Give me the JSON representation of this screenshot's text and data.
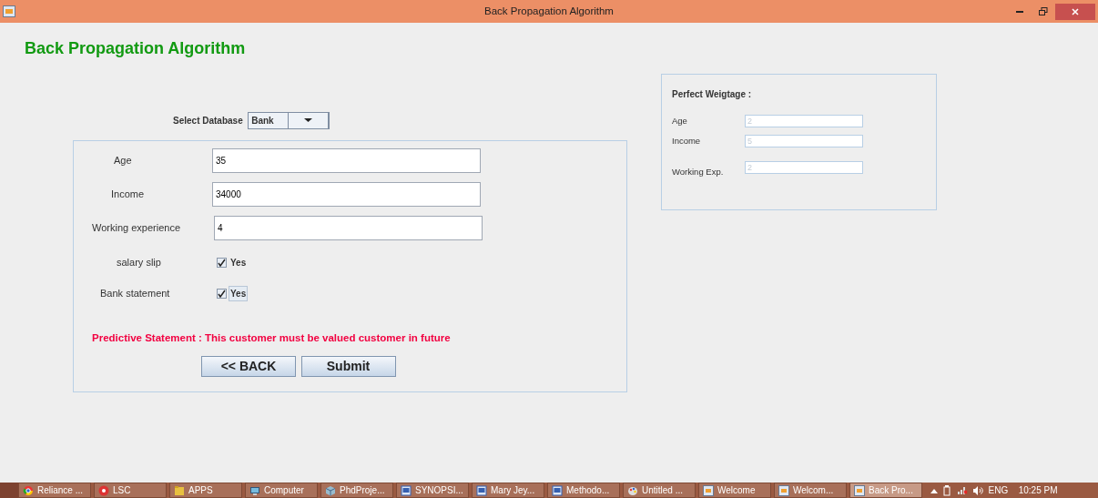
{
  "window": {
    "title": "Back Propagation Algorithm"
  },
  "heading": "Back Propagation Algorithm",
  "database": {
    "label": "Select Database",
    "value": "Bank"
  },
  "fields": [
    {
      "label": "Age",
      "value": "35"
    },
    {
      "label": "Income",
      "value": "34000"
    },
    {
      "label": "Working experience",
      "value": "4"
    }
  ],
  "checks": [
    {
      "label": "salary slip",
      "option": "Yes",
      "checked": true,
      "focused": false
    },
    {
      "label": "Bank statement",
      "option": "Yes",
      "checked": true,
      "focused": true
    }
  ],
  "prediction": "Predictive Statement : This customer must be valued customer in future",
  "buttons": [
    "<< BACK",
    "Submit"
  ],
  "weightage": {
    "title": "Perfect Weigtage :",
    "fields": [
      {
        "label": "Age",
        "value": "2",
        "disabled": true
      },
      {
        "label": "Income",
        "value": "5",
        "disabled": true
      },
      {
        "label": "Working Exp.",
        "value": "2",
        "disabled": true
      }
    ]
  },
  "taskbar": {
    "items": [
      {
        "label": "Reliance ...",
        "kind": "browser",
        "selected": false
      },
      {
        "label": "LSC",
        "kind": "flower",
        "selected": false
      },
      {
        "label": "APPS",
        "kind": "folder",
        "selected": false
      },
      {
        "label": "Computer",
        "kind": "computer",
        "selected": false
      },
      {
        "label": "PhdProje...",
        "kind": "cube",
        "selected": false
      },
      {
        "label": "SYNOPSI...",
        "kind": "document",
        "selected": false
      },
      {
        "label": "Mary Jey...",
        "kind": "document",
        "selected": false
      },
      {
        "label": "Methodo...",
        "kind": "document",
        "selected": false
      },
      {
        "label": "Untitled ...",
        "kind": "paint",
        "selected": false
      },
      {
        "label": "Welcome",
        "kind": "java",
        "selected": false
      },
      {
        "label": "Welcom...",
        "kind": "java",
        "selected": false
      },
      {
        "label": "Back Pro...",
        "kind": "java",
        "selected": true
      }
    ],
    "language": "ENG",
    "time": "10:25 PM"
  }
}
